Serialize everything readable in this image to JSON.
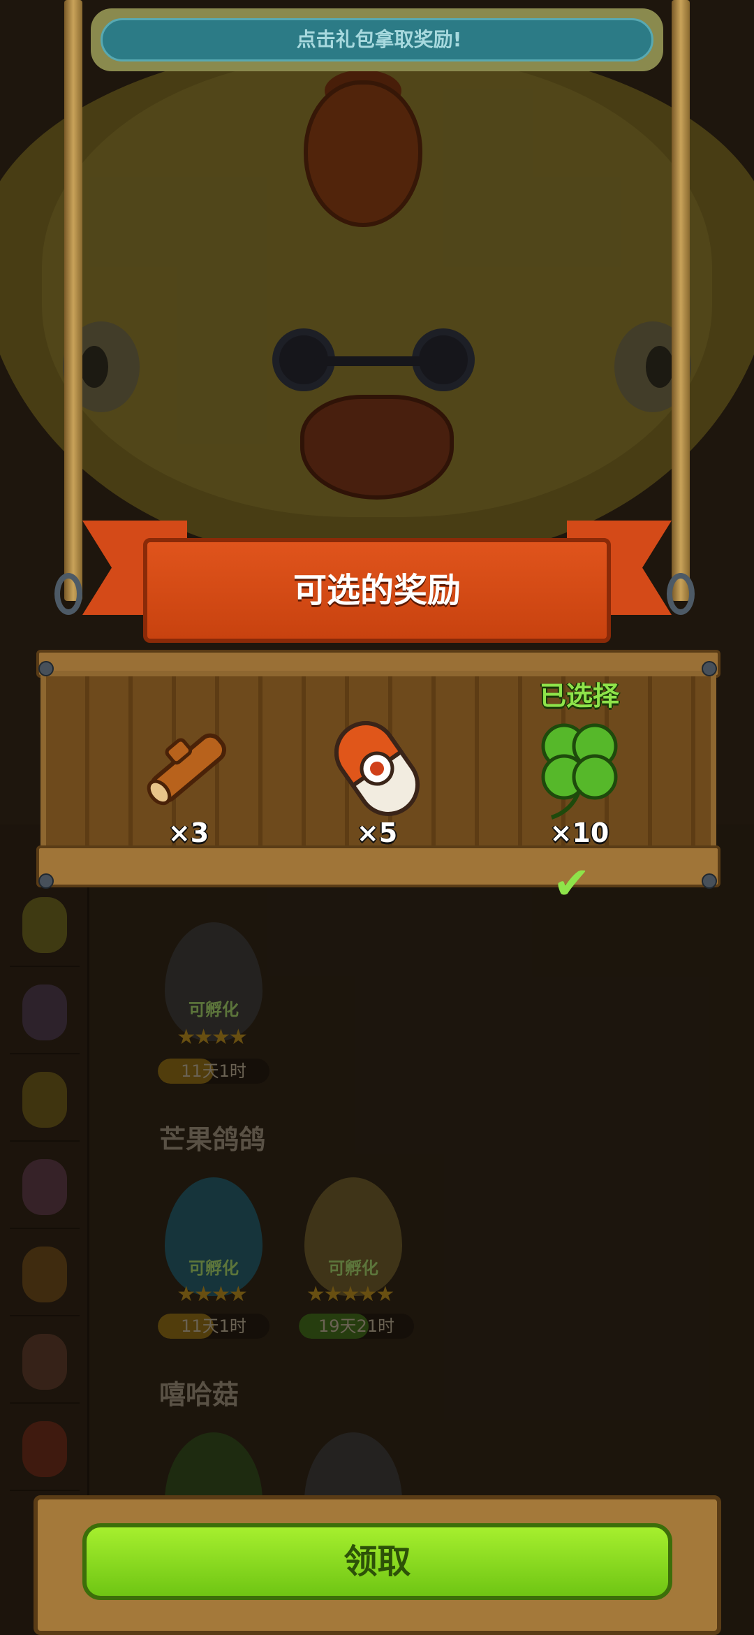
{
  "top_notice": {
    "text": "点击礼包拿取奖励!"
  },
  "panel": {
    "title": "可选的奖励",
    "selected_label": "已选择",
    "rewards": [
      {
        "icon": "wood-log-icon",
        "count": "×3",
        "selected": false
      },
      {
        "icon": "capsule-icon",
        "count": "×5",
        "selected": false
      },
      {
        "icon": "four-leaf-clover-icon",
        "count": "×10",
        "selected": true
      }
    ]
  },
  "background": {
    "groups": [
      {
        "title": "芒果鸽鸽",
        "eggs": [
          {
            "status": "可孵化",
            "stars": "★★★★",
            "timer": "11天1时"
          },
          {
            "status": "可孵化",
            "stars": "★★★★★",
            "timer": "19天21时"
          }
        ]
      },
      {
        "title": "嘻哈菇",
        "eggs": []
      }
    ],
    "first_egg": {
      "status": "可孵化",
      "stars": "★★★★",
      "timer": "11天1时"
    }
  },
  "footer": {
    "claim_label": "领取"
  },
  "colors": {
    "accent_green": "#8ee34a",
    "ribbon_red": "#d44a18",
    "button_green": "#88dc1e"
  }
}
